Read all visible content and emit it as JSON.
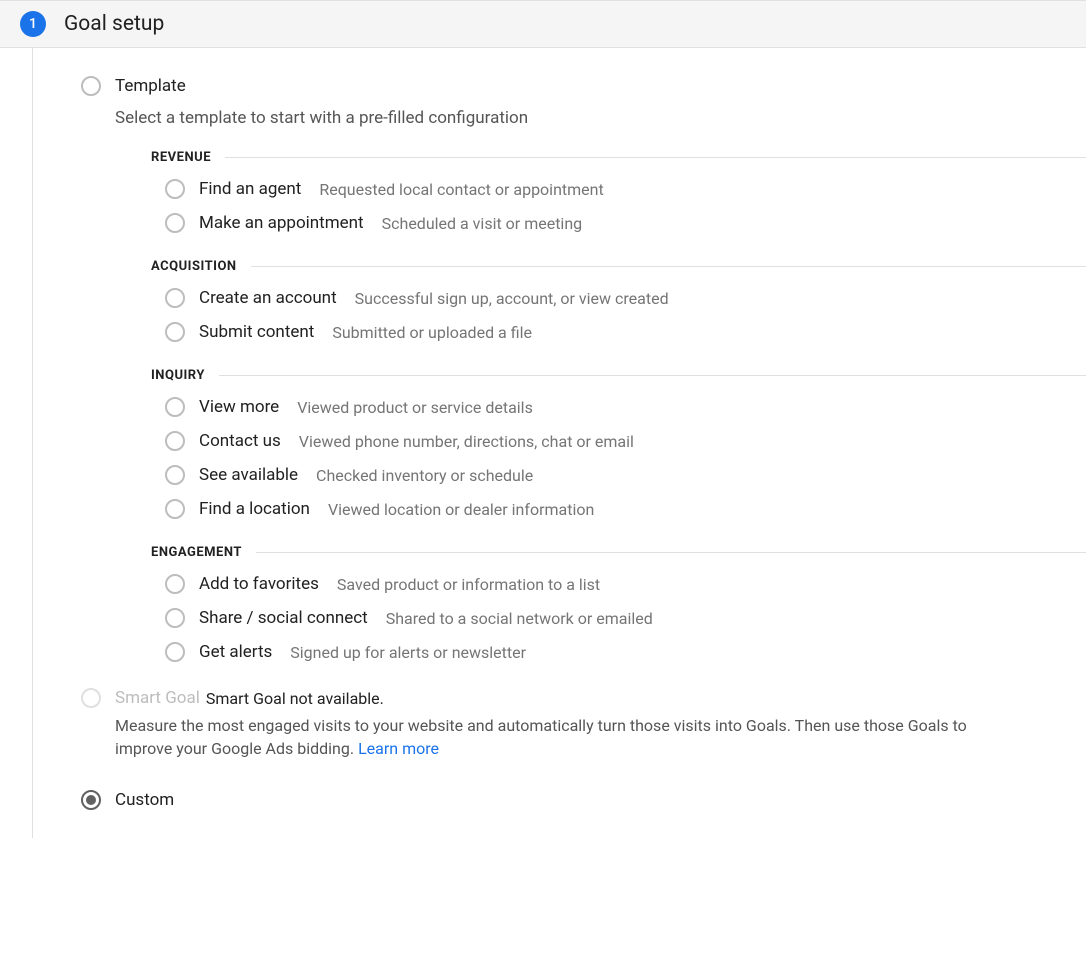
{
  "step": {
    "number": "1",
    "title": "Goal setup"
  },
  "template": {
    "label": "Template",
    "helper": "Select a template to start with a pre-filled configuration",
    "groups": [
      {
        "name": "REVENUE",
        "items": [
          {
            "label": "Find an agent",
            "desc": "Requested local contact or appointment"
          },
          {
            "label": "Make an appointment",
            "desc": "Scheduled a visit or meeting"
          }
        ]
      },
      {
        "name": "ACQUISITION",
        "items": [
          {
            "label": "Create an account",
            "desc": "Successful sign up, account, or view created"
          },
          {
            "label": "Submit content",
            "desc": "Submitted or uploaded a file"
          }
        ]
      },
      {
        "name": "INQUIRY",
        "items": [
          {
            "label": "View more",
            "desc": "Viewed product or service details"
          },
          {
            "label": "Contact us",
            "desc": "Viewed phone number, directions, chat or email"
          },
          {
            "label": "See available",
            "desc": "Checked inventory or schedule"
          },
          {
            "label": "Find a location",
            "desc": "Viewed location or dealer information"
          }
        ]
      },
      {
        "name": "ENGAGEMENT",
        "items": [
          {
            "label": "Add to favorites",
            "desc": "Saved product or information to a list"
          },
          {
            "label": "Share / social connect",
            "desc": "Shared to a social network or emailed"
          },
          {
            "label": "Get alerts",
            "desc": "Signed up for alerts or newsletter"
          }
        ]
      }
    ]
  },
  "smart": {
    "label": "Smart Goal",
    "unavailable": "Smart Goal not available.",
    "desc": "Measure the most engaged visits to your website and automatically turn those visits into Goals. Then use those Goals to improve your Google Ads bidding. ",
    "learn_more": "Learn more"
  },
  "custom": {
    "label": "Custom"
  }
}
